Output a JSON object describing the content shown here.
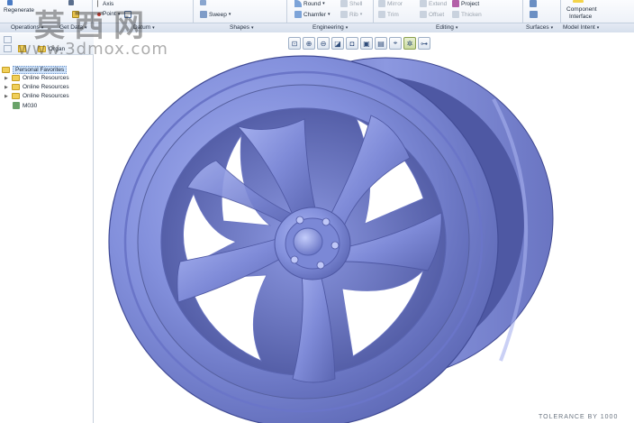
{
  "ribbon": {
    "regenerate": "Regenerate",
    "axis": "Axis",
    "point": "Point",
    "sweep": "Sweep",
    "round": "Round",
    "chamfer": "Chamfer",
    "shell": "Shell",
    "rib": "Rib",
    "mirror": "Mirror",
    "trim": "Trim",
    "extend": "Extend",
    "offset": "Offset",
    "project": "Project",
    "thicken": "Thicken",
    "component_interface_1": "Component",
    "component_interface_2": "Interface"
  },
  "groups": {
    "operations": "Operations",
    "get_data": "Get Data",
    "datum": "Datum",
    "shapes": "Shapes",
    "engineering": "Engineering",
    "editing": "Editing",
    "surfaces": "Surfaces",
    "model_intent": "Model Intent"
  },
  "tree": {
    "partial_label": "Organ",
    "personal_favorites": "Personal Favorites",
    "online_resources": [
      "Online Resources",
      "Online Resources",
      "Online Resources"
    ],
    "part": "M030"
  },
  "watermark": {
    "chinese": "莫西网",
    "url": "www.3dmox.com"
  },
  "status": {
    "bottom_text": "TOLERANCE BY 1000"
  }
}
